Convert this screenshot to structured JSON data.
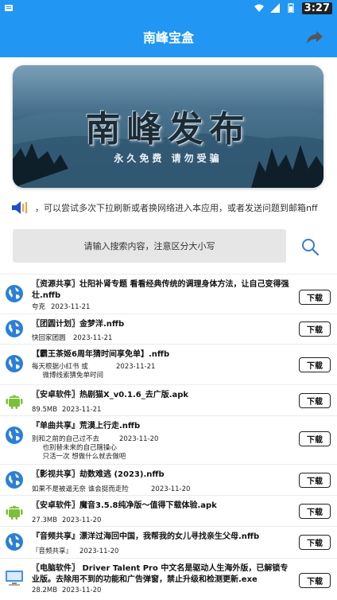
{
  "status_bar": {
    "time": "3:27",
    "icons": [
      "signal-icon",
      "wifi-icon",
      "cellular-icon",
      "battery-icon"
    ]
  },
  "app_bar": {
    "title": "南峰宝盒",
    "share_icon": "share-icon"
  },
  "banner": {
    "big_text": "南峰发布",
    "small_text": "永久免费 请勿受骗"
  },
  "notice": {
    "text": "，可以尝试多次下拉刷新或者换网络进入本应用，或者发送问题到邮箱nff"
  },
  "search": {
    "placeholder": "请输入搜索内容，注意区分大小写",
    "icon": "search-icon"
  },
  "download_label": "下载",
  "items": [
    {
      "icon": "globe-icon",
      "title": "〖资源共享〗壮阳补肾专题 看看经典传统的调理身体方法，让自己变得强壮.nffb",
      "size": "夸克",
      "date": "2023-11-21"
    },
    {
      "icon": "globe-icon",
      "title": "〖团圆计划〗金梦洋.nffb",
      "size": "快回家团圆",
      "date": "2023-11-21"
    },
    {
      "icon": "globe-icon",
      "title": "【霸王茶姬6周年猜时间享免单】.nffb",
      "size": "每天根据小红书 或\n     微博线索猜免单时间",
      "date": "2023-11-21"
    },
    {
      "icon": "android-icon",
      "title": "〖安卓软件〗热剧猫X_v0.1.6_去广版.apk",
      "size": "89.5MB",
      "date": "2023-11-21"
    },
    {
      "icon": "globe-icon",
      "title": "『单曲共享』荒漠上行走.nffb",
      "size": "别和之前的自己过不去\n     也别替未来的自己瞎操心\n     只活一次 想做什么就去做吧",
      "date": "2023-11-20"
    },
    {
      "icon": "globe-icon",
      "title": "〖影视共享〗劫数难逃 (2023).nffb",
      "size": "如果不是被逼无奈 谁会挺而走险",
      "date": "2023-11-20"
    },
    {
      "icon": "android-icon",
      "title": "〖安卓软件〗魔音3.5.8纯净版～值得下载体验.apk",
      "size": "27.3MB",
      "date": "2023-11-20"
    },
    {
      "icon": "globe-icon",
      "title": "『音频共享』漂洋过海回中国，我帮我的女儿寻找亲生父母.nffb",
      "size": "『音频共享』",
      "date": "2023-11-20"
    },
    {
      "icon": "computer-icon",
      "title": "〖电脑软件〗 Driver Talent Pro 中文名是驱动人生海外版，已解锁专业版。去除用不到的功能和广告弹窗，禁止升级和检测更新.exe",
      "size": "28.2MB",
      "date": "2023-11-20"
    }
  ]
}
